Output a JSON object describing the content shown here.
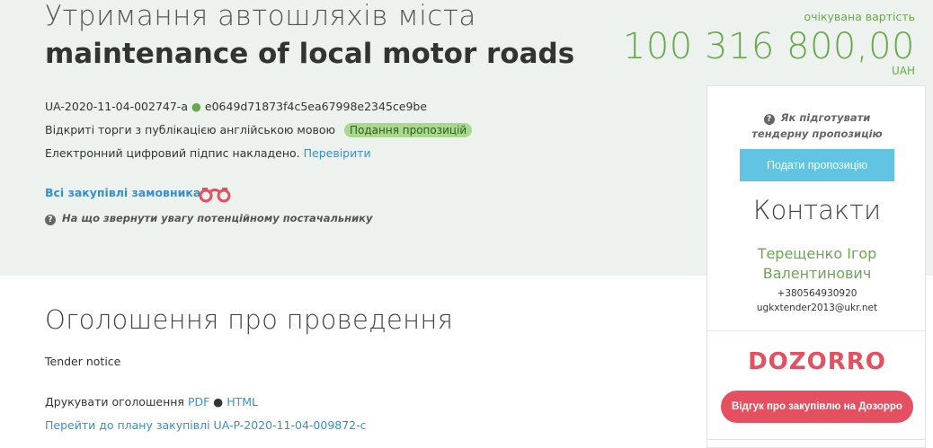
{
  "header": {
    "title_ua": "Утримання автошляхів міста",
    "title_en": "maintenance of local motor roads"
  },
  "tender": {
    "id": "UA-2020-11-04-002747-a",
    "hash": "e0649d71873f4c5ea67998e2345ce9be",
    "procedure": "Відкриті торги з публікацією англійською мовою",
    "status_badge": "Подання пропозицій",
    "signature_text": "Електронний цифровий підпис накладено.",
    "signature_link": "Перевірити",
    "buyer_link": "Всі закупівлі замовника",
    "supplier_hint": "На що звернути увагу потенційному постачальнику"
  },
  "price": {
    "label": "очікувана вартість",
    "value": "100 316 800,00",
    "currency": "UAH"
  },
  "panel": {
    "help_text": "Як підготувати тендерну пропозицію",
    "submit_label": "Подати пропозицію",
    "contacts_title": "Контакти",
    "contact_name": "Терещенко Ігор Валентинович",
    "contact_phone": "+380564930920",
    "contact_email": "ugkxtender2013@ukr.net",
    "dozorro_logo": "DOZORRO",
    "dozorro_button": "Відгук про закупівлю на Дозорро"
  },
  "announcement": {
    "title": "Оголошення про проведення",
    "notice": "Tender notice",
    "print_label": "Друкувати оголошення",
    "pdf_link": "PDF",
    "html_link": "HTML",
    "plan_link": "Перейти до плану закупівлі UA-P-2020-11-04-009872-c"
  },
  "colors": {
    "accent_green": "#6aa84f",
    "link_blue": "#3a8ecc",
    "submit_blue": "#62c4e3",
    "dozorro_red": "#e4505f",
    "hero_bg": "#edf2ee"
  }
}
